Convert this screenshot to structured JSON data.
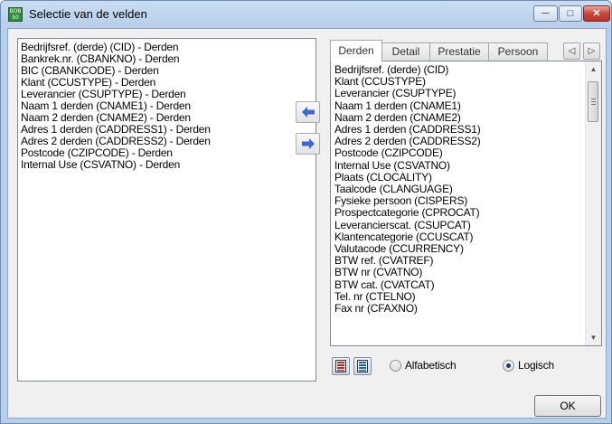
{
  "window": {
    "title": "Selectie van de velden",
    "app_icon_text": "BOB 50",
    "controls": {
      "minimize": "─",
      "maximize": "□",
      "close": "✕"
    }
  },
  "selected_fields": [
    "Bedrijfsref. (derde) (CID) - Derden",
    "Bankrek.nr. (CBANKNO) - Derden",
    "BIC (CBANKCODE) - Derden",
    "Klant (CCUSTYPE) - Derden",
    "Leverancier (CSUPTYPE) - Derden",
    "Naam 1 derden (CNAME1) - Derden",
    "Naam 2 derden (CNAME2) - Derden",
    "Adres 1 derden (CADDRESS1) - Derden",
    "Adres 2 derden (CADDRESS2) - Derden",
    "Postcode (CZIPCODE) - Derden",
    "Internal Use (CSVATNO) - Derden"
  ],
  "tabs": [
    {
      "label": "Derden",
      "active": true
    },
    {
      "label": "Detail",
      "active": false
    },
    {
      "label": "Prestatie",
      "active": false
    },
    {
      "label": "Persoon",
      "active": false
    }
  ],
  "tab_scroll": {
    "left": "◁",
    "right": "▷"
  },
  "available_fields": [
    "Bedrijfsref. (derde) (CID)",
    "Klant (CCUSTYPE)",
    "Leverancier (CSUPTYPE)",
    "Naam 1 derden (CNAME1)",
    "Naam 2 derden (CNAME2)",
    "Adres 1 derden (CADDRESS1)",
    "Adres 2 derden (CADDRESS2)",
    "Postcode (CZIPCODE)",
    "Internal Use (CSVATNO)",
    "Plaats (CLOCALITY)",
    "Taalcode (CLANGUAGE)",
    "Fysieke persoon (CISPERS)",
    "Prospectcategorie (CPROCAT)",
    "Leverancierscat. (CSUPCAT)",
    "Klantencategorie (CCUSCAT)",
    "Valutacode (CCURRENCY)",
    "BTW ref. (CVATREF)",
    "BTW nr (CVATNO)",
    "BTW cat. (CVATCAT)",
    "Tel. nr (CTELNO)",
    "Fax nr (CFAXNO)"
  ],
  "sort": {
    "alphabetical_label": "Alfabetisch",
    "logical_label": "Logisch",
    "selected": "logical"
  },
  "ok_label": "OK",
  "colors": {
    "arrow_blue": "#3f66d6",
    "title_bar": "#c9dcf1"
  }
}
